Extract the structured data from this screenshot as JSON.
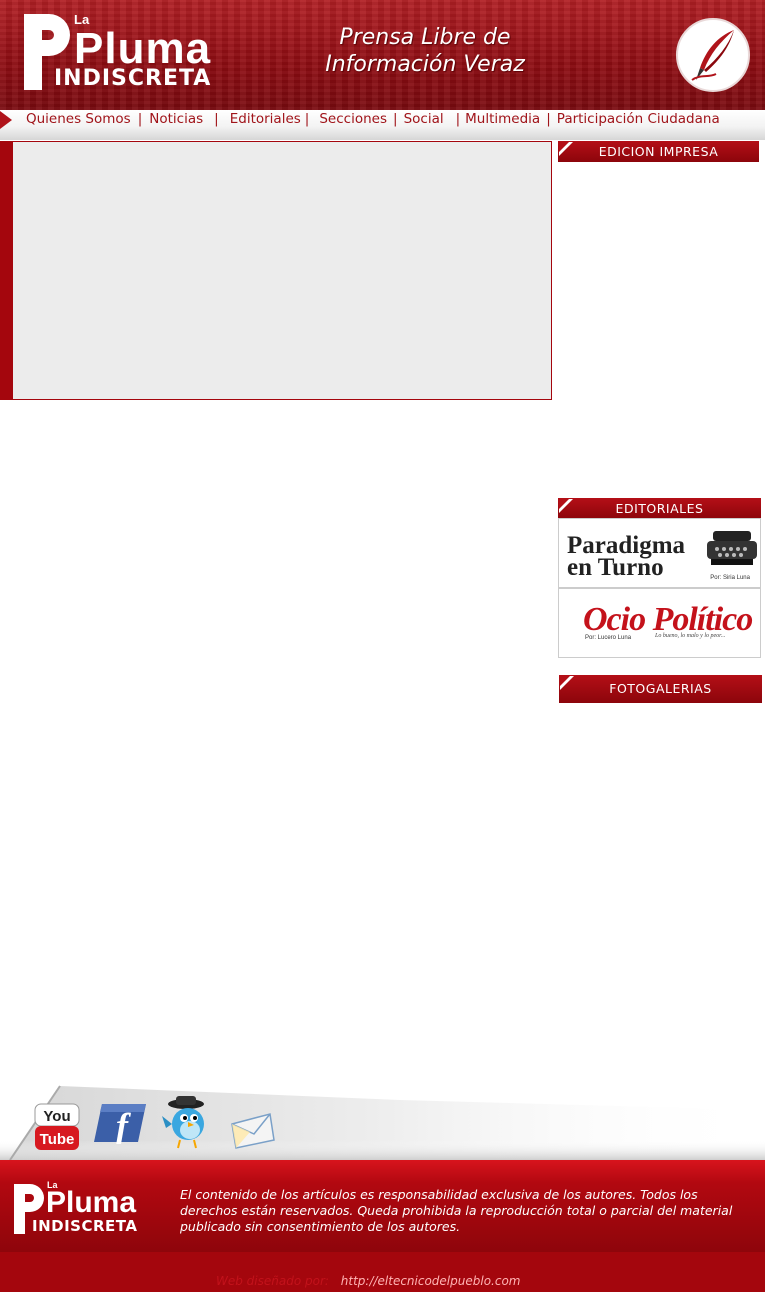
{
  "header": {
    "logo": {
      "la": "La",
      "pluma": "Pluma",
      "indiscreta": "INDISCRETA"
    },
    "tagline_line1": "Prensa Libre de",
    "tagline_line2": "Información Veraz",
    "emblem_icon": "quill-pen-icon"
  },
  "nav": {
    "items": [
      "Quienes Somos",
      "Noticias",
      "Editoriales",
      "Secciones",
      "Social",
      "Multimedia",
      "Participación Ciudadana"
    ],
    "separator": "|"
  },
  "sidebar": {
    "edicion_impresa": "EDICION IMPRESA",
    "editoriales": "EDITORIALES",
    "fotogalerias": "FOTOGALERIAS",
    "editorial_items": [
      {
        "title_line1": "Paradigma",
        "title_line2": "en Turno",
        "author": "Por: Siria Luna"
      },
      {
        "title": "Ocio Político",
        "author": "Por: Lucero Luna",
        "slogan": "Lo bueno, lo malo y lo peor..."
      }
    ]
  },
  "social": [
    "youtube-icon",
    "facebook-icon",
    "twitter-bird-icon",
    "email-envelope-icon"
  ],
  "footer": {
    "logo": {
      "la": "La",
      "pluma": "Pluma",
      "indiscreta": "INDISCRETA"
    },
    "disclaimer": "El contenido de los artículos es responsabilidad exclusiva de los autores. Todos los derechos están reservados. Queda prohibida la reproducción total o parcial del material publicado sin consentimiento de los autores.",
    "credit_label": "Web diseñado por:",
    "credit_link": "http://eltecnicodelpueblo.com"
  },
  "colors": {
    "brand_red": "#a4060d",
    "nav_text": "#a0141a",
    "slider_bg": "#ececec"
  }
}
